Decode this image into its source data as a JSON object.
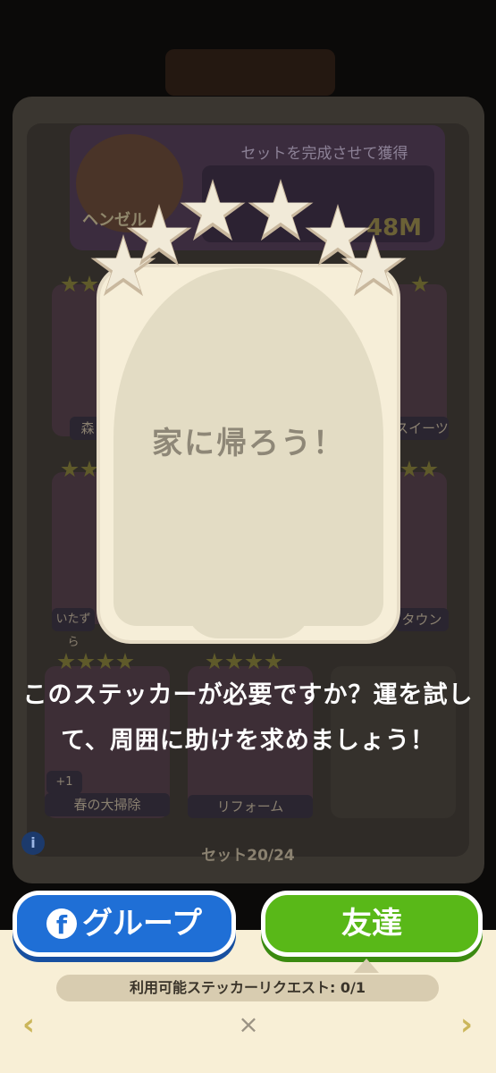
{
  "background": {
    "header_text": "セットを完成させて獲得",
    "prize_amount": "48M",
    "character_label": "ヘンゼル",
    "cards": [
      {
        "label": "森"
      },
      {
        "label": "スイーツ"
      },
      {
        "label": "いたずら"
      },
      {
        "label": "タウン"
      },
      {
        "label": "春の大掃除",
        "badge": "+1"
      },
      {
        "label": "リフォーム"
      }
    ],
    "set_progress": "セット20/24",
    "info_icon": "i"
  },
  "sticker": {
    "title": "家に帰ろう！",
    "stars": 6
  },
  "prompt": {
    "text": "このステッカーが必要ですか？運を試して、周囲に助けを求めましょう！"
  },
  "buttons": {
    "group_label": "グループ",
    "friends_label": "友達"
  },
  "request_info": "利用可能ステッカーリクエスト: 0/1",
  "navigation": {
    "prev": "‹",
    "next": "›",
    "close": "×"
  },
  "colors": {
    "group_button": "#1f6fd6",
    "friends_button": "#59b818",
    "panel_bg": "#f8efd6",
    "sticker_bg": "#f6eed8"
  }
}
